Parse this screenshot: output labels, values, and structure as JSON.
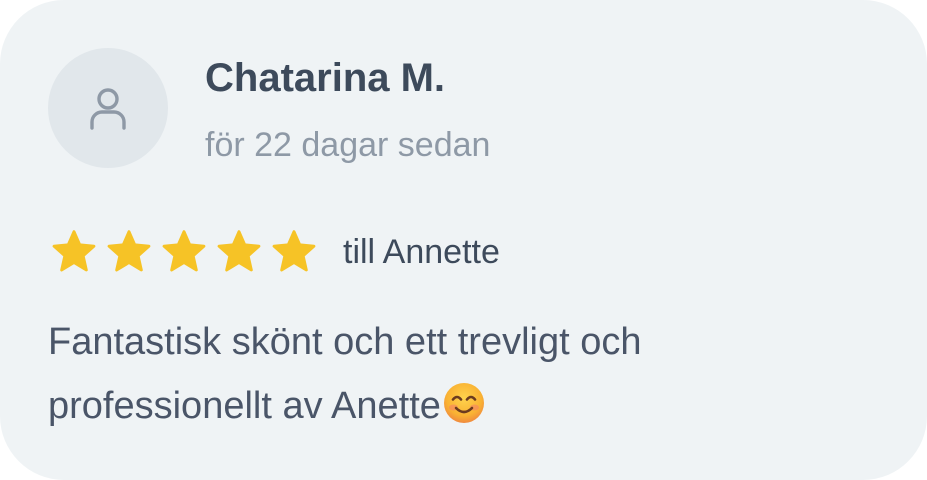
{
  "review": {
    "author_name": "Chatarina M.",
    "time_ago": "för 22 dagar sedan",
    "rating": 5,
    "rating_max": 5,
    "recipient": "till Annette",
    "text": "Fantastisk skönt och ett trevligt och professionellt av Anette",
    "emoji": "smiling-face-emoji"
  },
  "icons": {
    "avatar": "user-icon",
    "star": "star-icon"
  },
  "colors": {
    "card_background": "#eff3f5",
    "avatar_background": "#e1e7eb",
    "star": "#f6c326",
    "name": "#3d4a5b",
    "muted": "#8e99a6",
    "body_text": "#4a5568"
  }
}
